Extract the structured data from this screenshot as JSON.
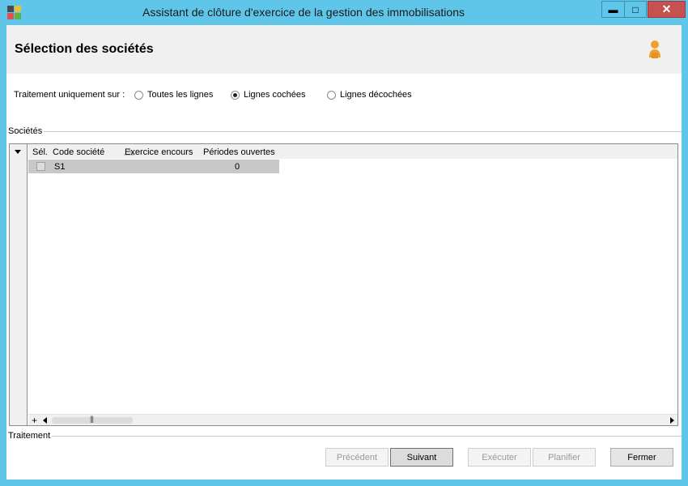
{
  "window": {
    "title": "Assistant de clôture d'exercice de la gestion des immobilisations",
    "minimize_label": "▬",
    "maximize_label": "□",
    "close_label": "✕"
  },
  "header": {
    "title": "Sélection des sociétés",
    "icon": "person-icon"
  },
  "options": {
    "label": "Traitement uniquement sur :",
    "radios": [
      {
        "label": "Toutes les lignes",
        "checked": false
      },
      {
        "label": "Lignes cochées",
        "checked": true
      },
      {
        "label": "Lignes décochées",
        "checked": false
      }
    ]
  },
  "societes": {
    "group_label": "Sociétés",
    "columns": [
      "Sél.",
      "Code société",
      "Exercice encours",
      "Périodes ouvertes"
    ],
    "rows": [
      {
        "selected": false,
        "code": "S1",
        "exercice": "",
        "periodes": "0"
      }
    ],
    "add_label": "+",
    "scroll_grip": "|||"
  },
  "traitement": {
    "group_label": "Traitement"
  },
  "buttons": {
    "precedent": "Précédent",
    "suivant": "Suivant",
    "executer": "Exécuter",
    "planifier": "Planifier",
    "fermer": "Fermer"
  },
  "colors": {
    "title_bar": "#5fc6ea",
    "close_button": "#c75050",
    "row_highlight": "#c8c8c8",
    "person_icon": "#f0a030"
  }
}
